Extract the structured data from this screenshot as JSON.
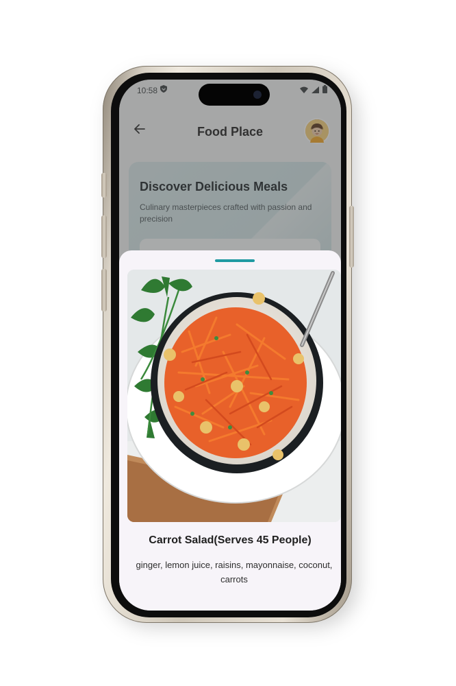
{
  "status_bar": {
    "time": "10:58",
    "left_icon": "vpn-shield-icon",
    "right_icons": [
      "wifi-icon",
      "signal-icon",
      "battery-icon"
    ]
  },
  "app_bar": {
    "title": "Food Place",
    "back_icon": "arrow-left-icon",
    "avatar": "user-avatar"
  },
  "hero": {
    "title": "Discover Delicious Meals",
    "subtitle": "Culinary masterpieces crafted with passion and precision"
  },
  "sheet": {
    "dish_name": "Carrot Salad(Serves 45 People)",
    "ingredients": "ginger, lemon juice, raisins, mayonnaise, coconut, carrots",
    "image": "carrot-salad-photo"
  },
  "colors": {
    "accent": "#1f9aa2",
    "sheet_background": "#f7f4f9",
    "scrim": "#464848"
  }
}
